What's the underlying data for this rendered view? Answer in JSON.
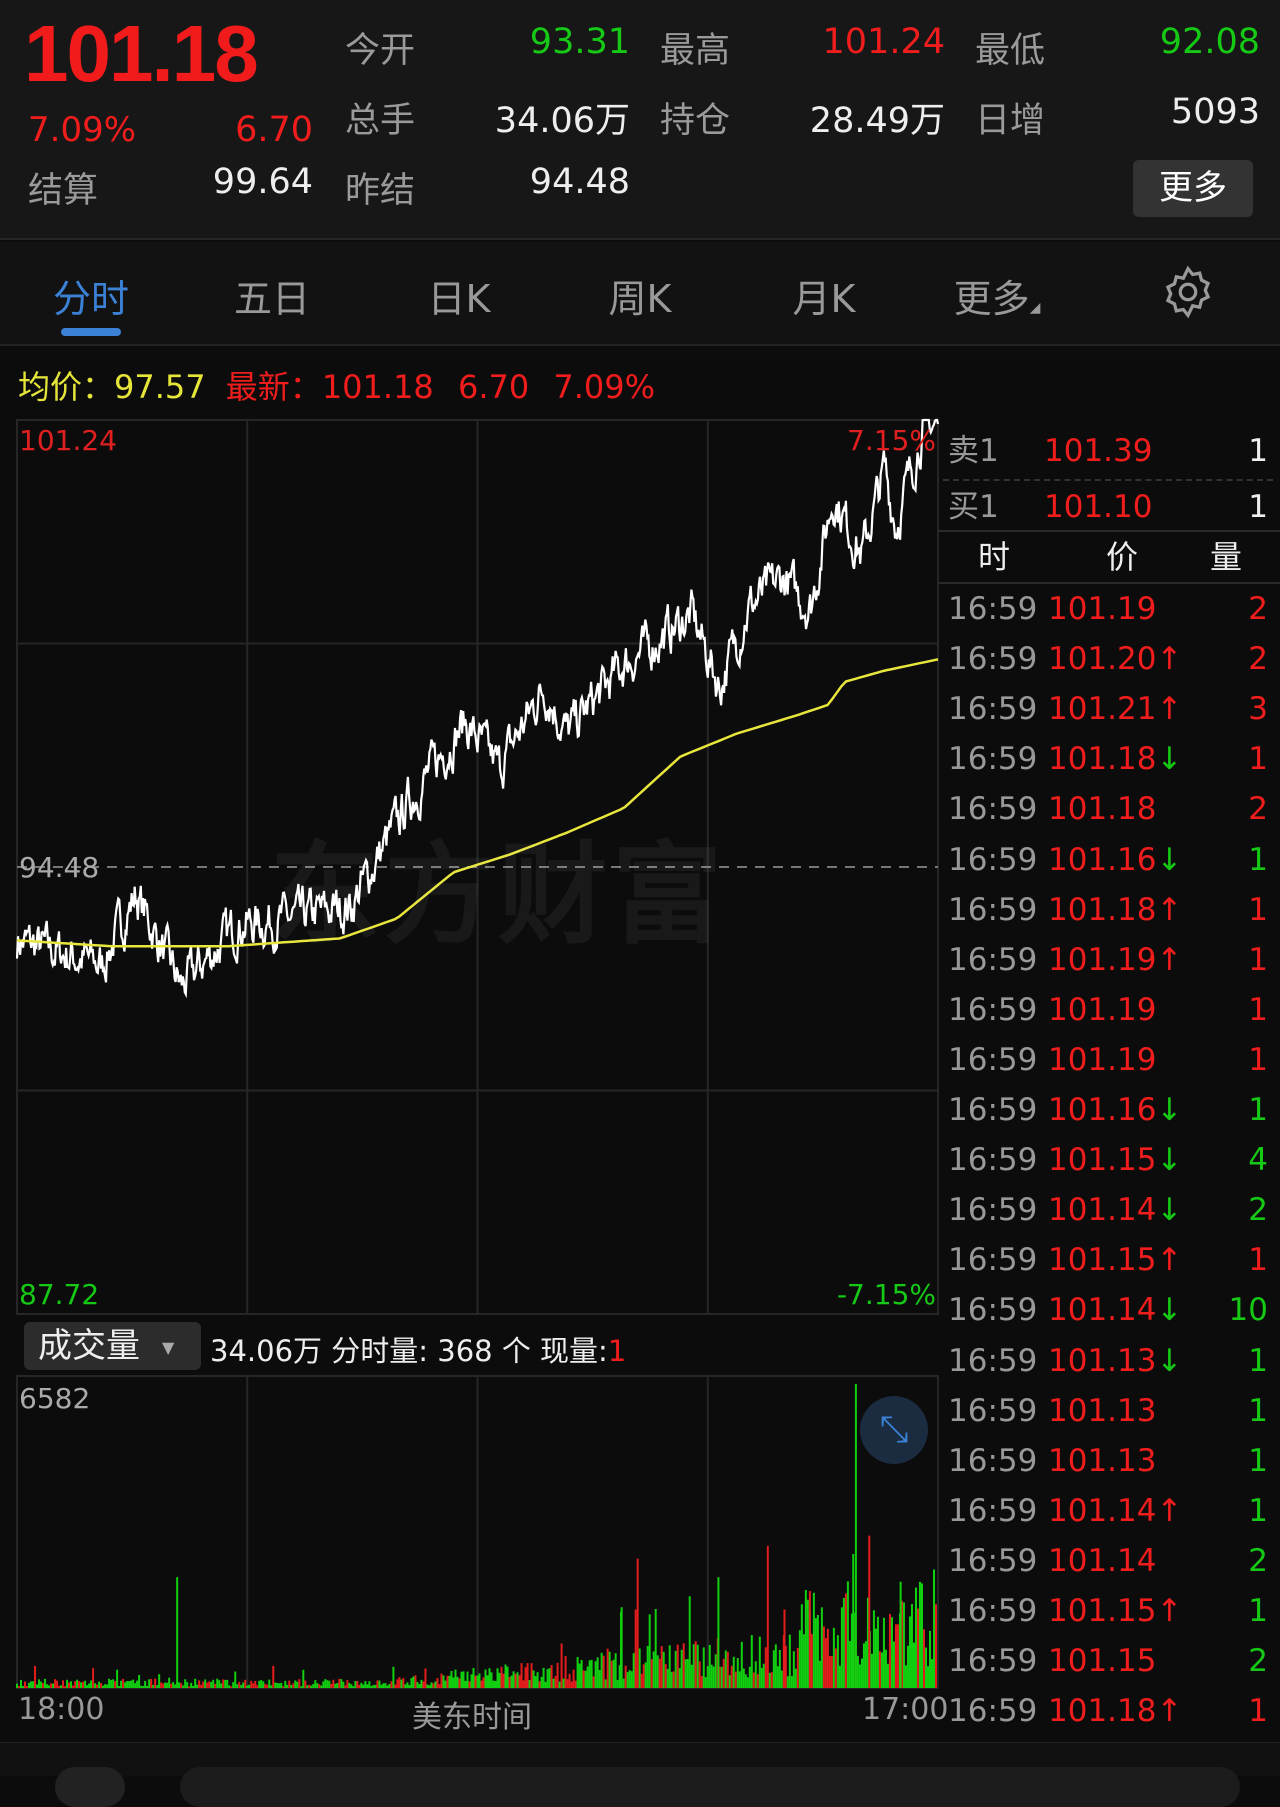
{
  "quote": {
    "price": "101.18",
    "change_pct": "7.09%",
    "change": "6.70",
    "fields": [
      {
        "label": "今开",
        "value": "93.31",
        "color": "green"
      },
      {
        "label": "最高",
        "value": "101.24",
        "color": "red"
      },
      {
        "label": "最低",
        "value": "92.08",
        "color": "green"
      },
      {
        "label": "总手",
        "value": "34.06万",
        "color": "white"
      },
      {
        "label": "持仓",
        "value": "28.49万",
        "color": "white"
      },
      {
        "label": "日增",
        "value": "5093",
        "color": "white"
      },
      {
        "label": "结算",
        "value": "99.64",
        "color": "white"
      },
      {
        "label": "昨结",
        "value": "94.48",
        "color": "white"
      }
    ],
    "more": "更多"
  },
  "tabs": [
    "分时",
    "五日",
    "日K",
    "周K",
    "月K",
    "更多"
  ],
  "info": {
    "avg_label": "均价：",
    "avg": "97.57",
    "latest_label": "最新：",
    "latest": "101.18",
    "change": "6.70",
    "pct": "7.09%"
  },
  "watermark": "东方财富",
  "order_book": [
    {
      "label": "卖1",
      "price": "101.39",
      "vol": "1"
    },
    {
      "label": "买1",
      "price": "101.10",
      "vol": "1"
    }
  ],
  "trade_headers": [
    "时",
    "价",
    "量"
  ],
  "trades": [
    [
      "16:59",
      "101.19",
      "",
      "2",
      "red"
    ],
    [
      "16:59",
      "101.20",
      "up",
      "2",
      "red"
    ],
    [
      "16:59",
      "101.21",
      "up",
      "3",
      "red"
    ],
    [
      "16:59",
      "101.18",
      "down",
      "1",
      "red"
    ],
    [
      "16:59",
      "101.18",
      "",
      "2",
      "red"
    ],
    [
      "16:59",
      "101.16",
      "down",
      "1",
      "green"
    ],
    [
      "16:59",
      "101.18",
      "up",
      "1",
      "red"
    ],
    [
      "16:59",
      "101.19",
      "up",
      "1",
      "red"
    ],
    [
      "16:59",
      "101.19",
      "",
      "1",
      "red"
    ],
    [
      "16:59",
      "101.19",
      "",
      "1",
      "red"
    ],
    [
      "16:59",
      "101.16",
      "down",
      "1",
      "green"
    ],
    [
      "16:59",
      "101.15",
      "down",
      "4",
      "green"
    ],
    [
      "16:59",
      "101.14",
      "down",
      "2",
      "green"
    ],
    [
      "16:59",
      "101.15",
      "up",
      "1",
      "red"
    ],
    [
      "16:59",
      "101.14",
      "down",
      "10",
      "green"
    ],
    [
      "16:59",
      "101.13",
      "down",
      "1",
      "green"
    ],
    [
      "16:59",
      "101.13",
      "",
      "1",
      "green"
    ],
    [
      "16:59",
      "101.13",
      "",
      "1",
      "green"
    ],
    [
      "16:59",
      "101.14",
      "up",
      "1",
      "green"
    ],
    [
      "16:59",
      "101.14",
      "",
      "2",
      "green"
    ],
    [
      "16:59",
      "101.15",
      "up",
      "1",
      "green"
    ],
    [
      "16:59",
      "101.15",
      "",
      "2",
      "green"
    ],
    [
      "16:59",
      "101.18",
      "up",
      "1",
      "red"
    ]
  ],
  "volume": {
    "selector": "成交量",
    "total": "34.06万",
    "minute_label": "分时量:",
    "minute_value": "368 个",
    "current_label": "现量:",
    "current_value": "1"
  },
  "chart_data": {
    "type": "line",
    "ylim": [
      87.72,
      101.24
    ],
    "prev_settle": 94.48,
    "y_labels": {
      "top": "101.24",
      "mid": "94.48",
      "bottom": "87.72",
      "top_pct": "7.15%",
      "bottom_pct": "-7.15%"
    },
    "x_labels": [
      "18:00",
      "美东时间",
      "17:00"
    ],
    "x_unit": "minutes since 18:00",
    "x_max": 1380,
    "price": [
      [
        0,
        93.37
      ],
      [
        127,
        93.0
      ],
      [
        178,
        94.06
      ],
      [
        246,
        92.67
      ],
      [
        331,
        93.6
      ],
      [
        416,
        93.7
      ],
      [
        501,
        93.9
      ],
      [
        586,
        95.45
      ],
      [
        671,
        96.67
      ],
      [
        722,
        95.98
      ],
      [
        790,
        97.2
      ],
      [
        824,
        96.5
      ],
      [
        909,
        97.54
      ],
      [
        960,
        97.9
      ],
      [
        1011,
        98.3
      ],
      [
        1053,
        97.2
      ],
      [
        1096,
        98.4
      ],
      [
        1147,
        98.85
      ],
      [
        1189,
        98.4
      ],
      [
        1223,
        100.1
      ],
      [
        1266,
        99.2
      ],
      [
        1300,
        100.5
      ],
      [
        1317,
        99.65
      ],
      [
        1360,
        101.2
      ],
      [
        1380,
        101.18
      ]
    ],
    "avg": [
      [
        0,
        93.37
      ],
      [
        144,
        93.28
      ],
      [
        314,
        93.28
      ],
      [
        484,
        93.4
      ],
      [
        569,
        93.7
      ],
      [
        654,
        94.4
      ],
      [
        739,
        94.67
      ],
      [
        824,
        95.0
      ],
      [
        909,
        95.37
      ],
      [
        994,
        96.15
      ],
      [
        1079,
        96.5
      ],
      [
        1164,
        96.76
      ],
      [
        1215,
        96.93
      ],
      [
        1240,
        97.28
      ],
      [
        1300,
        97.45
      ],
      [
        1380,
        97.62
      ]
    ],
    "volume_max": 6582,
    "volume_spikes": [
      [
        240,
        2400,
        "green"
      ],
      [
        905,
        1650,
        "green"
      ],
      [
        927,
        1700,
        "red"
      ],
      [
        1051,
        2400,
        "green"
      ],
      [
        1257,
        6582,
        "green"
      ],
      [
        1253,
        2900,
        "green"
      ],
      [
        1277,
        3300,
        "red"
      ],
      [
        1150,
        1700,
        "red"
      ],
      [
        1188,
        2100,
        "red"
      ],
      [
        1324,
        2300,
        "green"
      ],
      [
        930,
        2800,
        "red"
      ]
    ]
  }
}
